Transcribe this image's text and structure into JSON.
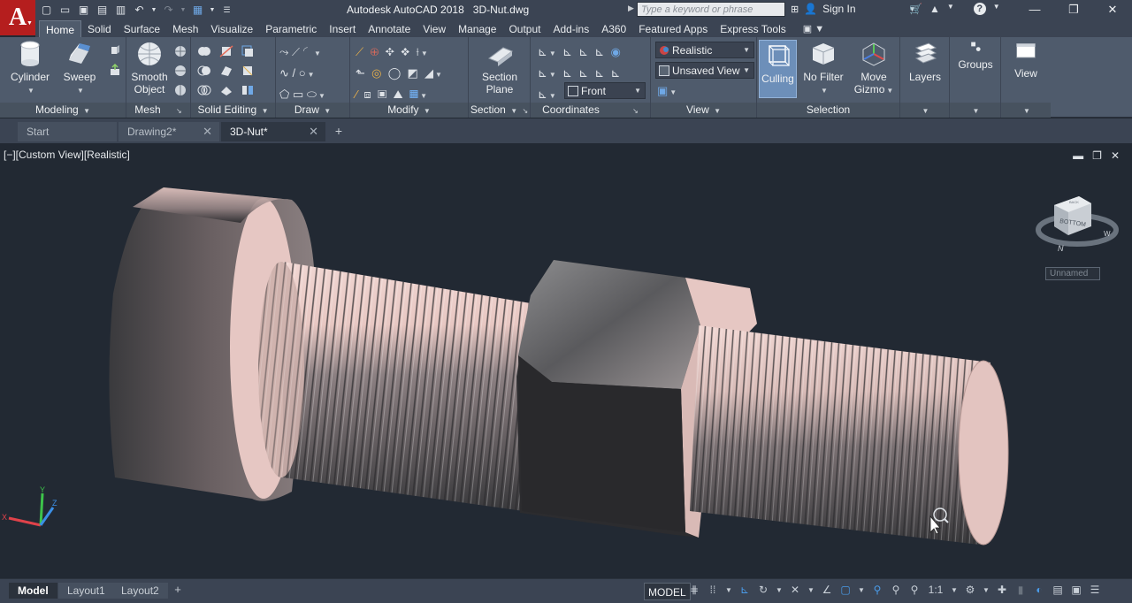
{
  "app": {
    "logo_letter": "A",
    "title": "Autodesk AutoCAD 2018",
    "document": "3D-Nut.dwg",
    "search_placeholder": "Type a keyword or phrase",
    "sign_in": "Sign In"
  },
  "ribbon_tabs": [
    "Home",
    "Solid",
    "Surface",
    "Mesh",
    "Visualize",
    "Parametric",
    "Insert",
    "Annotate",
    "View",
    "Manage",
    "Output",
    "Add-ins",
    "A360",
    "Featured Apps",
    "Express Tools"
  ],
  "ribbon_active_tab": "Home",
  "ribbon": {
    "modeling": {
      "label": "Modeling",
      "cylinder": "Cylinder",
      "sweep": "Sweep"
    },
    "mesh": {
      "label": "Mesh",
      "smooth_object_1": "Smooth",
      "smooth_object_2": "Object"
    },
    "solid_editing": {
      "label": "Solid Editing"
    },
    "draw": {
      "label": "Draw"
    },
    "modify": {
      "label": "Modify"
    },
    "section": {
      "label": "Section",
      "section_plane_1": "Section",
      "section_plane_2": "Plane"
    },
    "coordinates": {
      "label": "Coordinates",
      "ucs_combo": "Front"
    },
    "view": {
      "label": "View",
      "visual_style": "Realistic",
      "named_view": "Unsaved View"
    },
    "selection": {
      "label": "Selection",
      "culling": "Culling",
      "no_filter": "No Filter",
      "move_gizmo_1": "Move",
      "move_gizmo_2": "Gizmo"
    },
    "layers": {
      "label": "Layers"
    },
    "groups": {
      "label": "Groups"
    },
    "view_panel": {
      "label": "View"
    }
  },
  "file_tabs": [
    {
      "label": "Start",
      "closable": false
    },
    {
      "label": "Drawing2*",
      "closable": true
    },
    {
      "label": "3D-Nut*",
      "closable": true,
      "active": true
    }
  ],
  "viewport": {
    "label": "[−][Custom View][Realistic]",
    "viewcube_face": "BOTTOM",
    "viewcube_top": "BACK",
    "compass_n": "N",
    "compass_w": "W",
    "view_name": "Unnamed",
    "ucs_x": "X",
    "ucs_y": "Y",
    "ucs_z": "Z"
  },
  "layout_tabs": [
    "Model",
    "Layout1",
    "Layout2"
  ],
  "status": {
    "model": "MODEL",
    "scale": "1:1"
  },
  "colors": {
    "accent_blue": "#4a9be8",
    "logo_red": "#b51e1e",
    "bolt_pink": "#e6c6c2"
  }
}
